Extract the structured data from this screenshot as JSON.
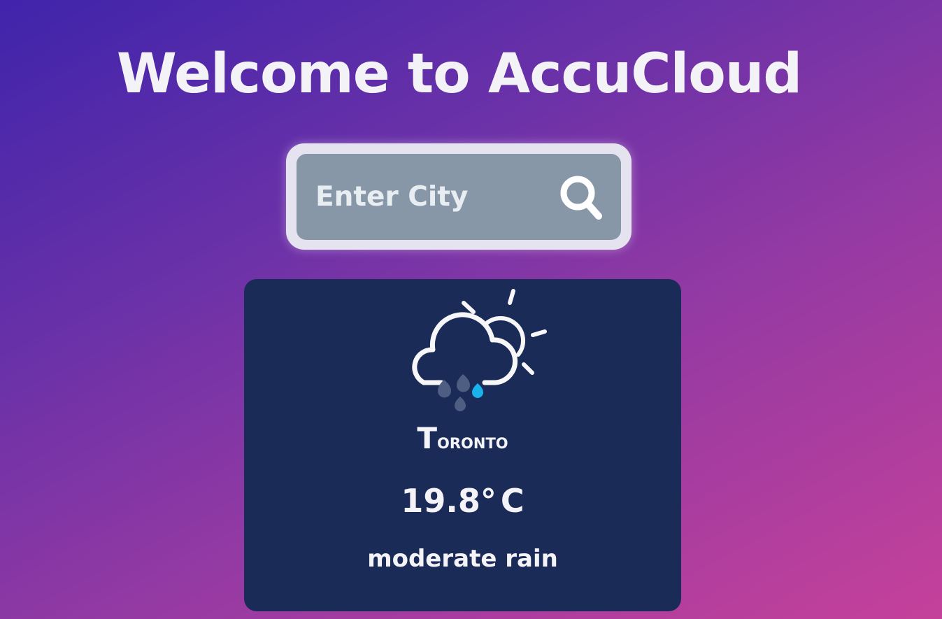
{
  "header": {
    "title": "Welcome to AccuCloud"
  },
  "search": {
    "placeholder": "Enter City",
    "value": "",
    "icon": "search-icon"
  },
  "weather": {
    "icon": "partly-cloudy-rain-icon",
    "city": "Toronto",
    "temperature": "19.8",
    "degree_symbol": "°",
    "unit": "C",
    "condition": "moderate rain"
  },
  "colors": {
    "background_start": "#3f24ab",
    "background_end": "#c5419a",
    "card": "#1b2b57",
    "search_box": "#8797a8",
    "rain_accent": "#1ab2ec"
  }
}
